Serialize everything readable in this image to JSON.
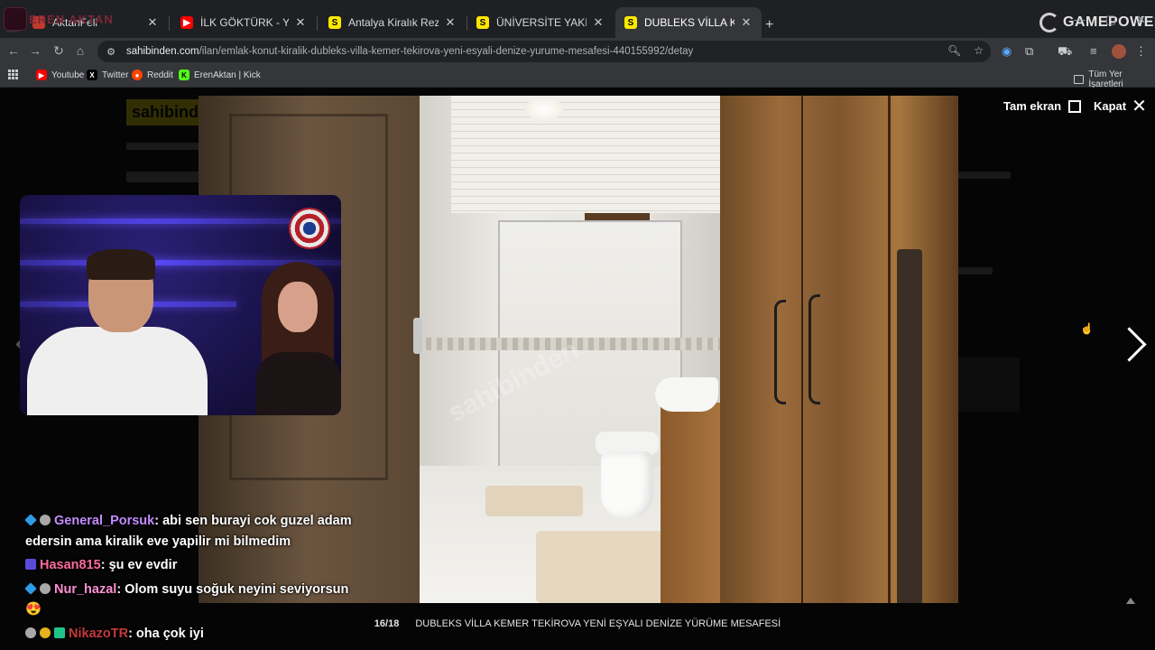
{
  "browser": {
    "tabs": [
      {
        "title": "AktanFeli",
        "favicon_color": "#c0392b",
        "active": false
      },
      {
        "title": "İLK GÖKTÜRK - YouTube",
        "favicon_color": "#ff0000",
        "active": false
      },
      {
        "title": "Antalya Kiralık Rezidans, Villa, M",
        "favicon_color": "#ffe800",
        "active": false
      },
      {
        "title": "ÜNİVERSİTE YAKINI HAVUZLU S",
        "favicon_color": "#ffe800",
        "active": false
      },
      {
        "title": "DUBLEKS VİLLA KEMER TEKİRO",
        "favicon_color": "#ffe800",
        "active": true
      }
    ],
    "url_host": "sahibinden.com",
    "url_path": "/ilan/emlak-konut-kiralik-dubleks-villa-kemer-tekirova-yeni-esyali-denize-yurume-mesafesi-440155992/detay",
    "bookmarks": [
      {
        "label": "Youtube",
        "icon_color": "#ff0000"
      },
      {
        "label": "Twitter",
        "icon_color": "#000000"
      },
      {
        "label": "Reddit",
        "icon_color": "#ff4500"
      },
      {
        "label": "ErenAktan | Kick",
        "icon_color": "#53fc18"
      }
    ],
    "all_bookmarks_label": "Tüm Yer İşaretleri"
  },
  "overlay": {
    "brand_logo_text": "GAMEPOWER",
    "stream_name": "EREN AKTAN"
  },
  "lightbox": {
    "fullscreen_label": "Tam ekran",
    "close_label": "Kapat",
    "counter": "16/18",
    "caption": "DUBLEKS VİLLA KEMER TEKİROVA YENİ EŞYALI DENİZE YÜRÜME MESAFESİ",
    "watermark": "sahibinden"
  },
  "background_page": {
    "logo_text": "sahibinden"
  },
  "chat": [
    {
      "user": "General_Porsuk",
      "text": ": abi sen burayi cok guzel adam edersin ama kiralik eve yapilir mi bilmedim"
    },
    {
      "user": "Hasan815",
      "text": ": şu ev evdir"
    },
    {
      "user": "Nur_hazal",
      "text": ": Olom suyu soğuk neyini seviyorsun 😍"
    },
    {
      "user": "NikazoTR",
      "text": ": oha çok iyi"
    }
  ]
}
